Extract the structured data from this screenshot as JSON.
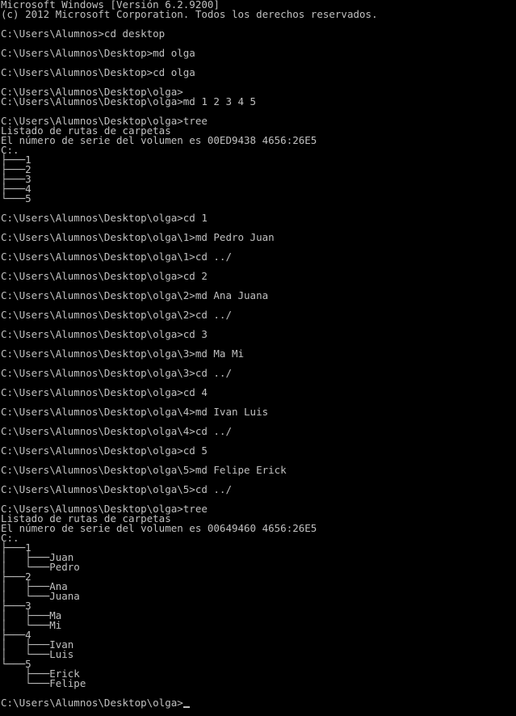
{
  "colors": {
    "background": "#000000",
    "text": "#c0c0c0"
  },
  "console": {
    "lines": [
      "Microsoft Windows [Versión 6.2.9200]",
      "(c) 2012 Microsoft Corporation. Todos los derechos reservados.",
      "",
      "C:\\Users\\Alumnos>cd desktop",
      "",
      "C:\\Users\\Alumnos\\Desktop>md olga",
      "",
      "C:\\Users\\Alumnos\\Desktop>cd olga",
      "",
      "C:\\Users\\Alumnos\\Desktop\\olga>",
      "C:\\Users\\Alumnos\\Desktop\\olga>md 1 2 3 4 5",
      "",
      "C:\\Users\\Alumnos\\Desktop\\olga>tree",
      "Listado de rutas de carpetas",
      "El número de serie del volumen es 00ED9438 4656:26E5",
      "C:.",
      "├───1",
      "├───2",
      "├───3",
      "├───4",
      "└───5",
      "",
      "C:\\Users\\Alumnos\\Desktop\\olga>cd 1",
      "",
      "C:\\Users\\Alumnos\\Desktop\\olga\\1>md Pedro Juan",
      "",
      "C:\\Users\\Alumnos\\Desktop\\olga\\1>cd ../",
      "",
      "C:\\Users\\Alumnos\\Desktop\\olga>cd 2",
      "",
      "C:\\Users\\Alumnos\\Desktop\\olga\\2>md Ana Juana",
      "",
      "C:\\Users\\Alumnos\\Desktop\\olga\\2>cd ../",
      "",
      "C:\\Users\\Alumnos\\Desktop\\olga>cd 3",
      "",
      "C:\\Users\\Alumnos\\Desktop\\olga\\3>md Ma Mi",
      "",
      "C:\\Users\\Alumnos\\Desktop\\olga\\3>cd ../",
      "",
      "C:\\Users\\Alumnos\\Desktop\\olga>cd 4",
      "",
      "C:\\Users\\Alumnos\\Desktop\\olga\\4>md Ivan Luis",
      "",
      "C:\\Users\\Alumnos\\Desktop\\olga\\4>cd ../",
      "",
      "C:\\Users\\Alumnos\\Desktop\\olga>cd 5",
      "",
      "C:\\Users\\Alumnos\\Desktop\\olga\\5>md Felipe Erick",
      "",
      "C:\\Users\\Alumnos\\Desktop\\olga\\5>cd ../",
      "",
      "C:\\Users\\Alumnos\\Desktop\\olga>tree",
      "Listado de rutas de carpetas",
      "El número de serie del volumen es 00649460 4656:26E5",
      "C:.",
      "├───1",
      "│   ├───Juan",
      "│   └───Pedro",
      "├───2",
      "│   ├───Ana",
      "│   └───Juana",
      "├───3",
      "│   ├───Ma",
      "│   └───Mi",
      "├───4",
      "│   ├───Ivan",
      "│   └───Luis",
      "└───5",
      "    ├───Erick",
      "    └───Felipe",
      ""
    ],
    "current_prompt": "C:\\Users\\Alumnos\\Desktop\\olga>"
  }
}
